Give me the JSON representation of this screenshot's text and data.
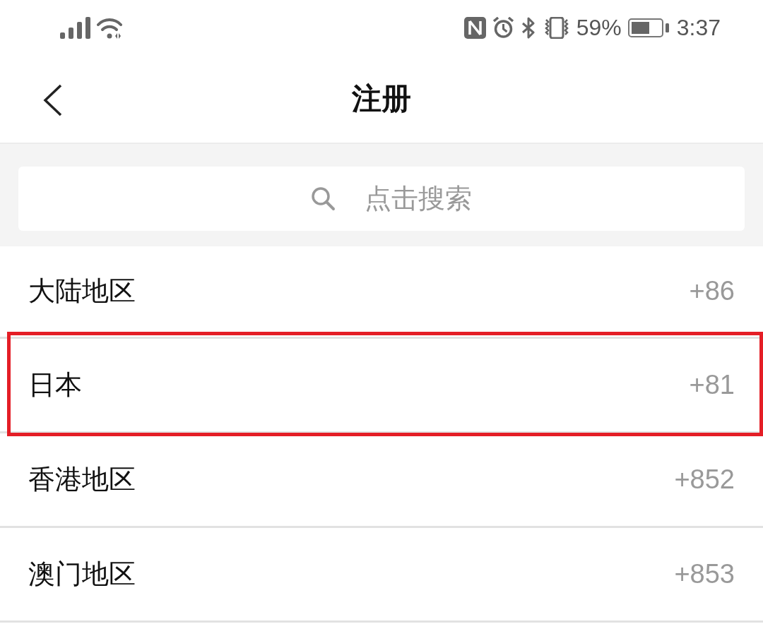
{
  "status_bar": {
    "battery_text": "59%",
    "time": "3:37"
  },
  "header": {
    "title": "注册"
  },
  "search": {
    "placeholder": "点击搜索"
  },
  "regions": [
    {
      "name": "大陆地区",
      "code": "+86",
      "highlighted": false
    },
    {
      "name": "日本",
      "code": "+81",
      "highlighted": true
    },
    {
      "name": "香港地区",
      "code": "+852",
      "highlighted": false
    },
    {
      "name": "澳门地区",
      "code": "+853",
      "highlighted": false
    }
  ]
}
